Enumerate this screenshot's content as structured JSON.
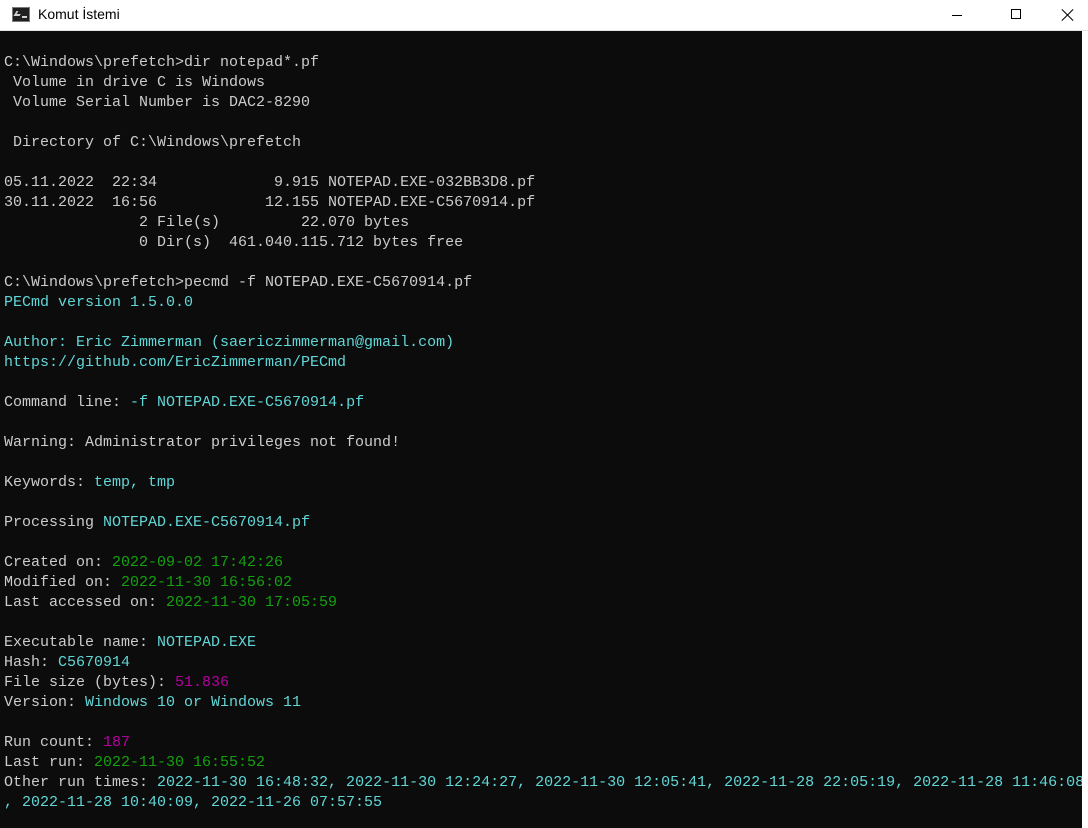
{
  "window": {
    "title": "Komut İstemi",
    "controls": {
      "minimize": "minimize",
      "maximize": "maximize",
      "close": "close"
    }
  },
  "colors": {
    "background": "#0c0c0c",
    "text": "#cccccc",
    "cyan": "#61d6d6",
    "green": "#13a10e",
    "magenta": "#b4009e"
  },
  "console": {
    "lines": [
      {
        "segments": [
          {
            "text": "C:\\Windows\\prefetch>dir notepad*.pf",
            "color": "w"
          }
        ]
      },
      {
        "segments": [
          {
            "text": " Volume in drive C is Windows",
            "color": "w"
          }
        ]
      },
      {
        "segments": [
          {
            "text": " Volume Serial Number is DAC2-8290",
            "color": "w"
          }
        ]
      },
      {
        "segments": []
      },
      {
        "segments": [
          {
            "text": " Directory of C:\\Windows\\prefetch",
            "color": "w"
          }
        ]
      },
      {
        "segments": []
      },
      {
        "segments": [
          {
            "text": "05.11.2022  22:34             9.915 NOTEPAD.EXE-032BB3D8.pf",
            "color": "w"
          }
        ]
      },
      {
        "segments": [
          {
            "text": "30.11.2022  16:56            12.155 NOTEPAD.EXE-C5670914.pf",
            "color": "w"
          }
        ]
      },
      {
        "segments": [
          {
            "text": "               2 File(s)         22.070 bytes",
            "color": "w"
          }
        ]
      },
      {
        "segments": [
          {
            "text": "               0 Dir(s)  461.040.115.712 bytes free",
            "color": "w"
          }
        ]
      },
      {
        "segments": []
      },
      {
        "segments": [
          {
            "text": "C:\\Windows\\prefetch>pecmd -f NOTEPAD.EXE-C5670914.pf",
            "color": "w"
          }
        ]
      },
      {
        "segments": [
          {
            "text": "PECmd version 1.5.0.0",
            "color": "c"
          }
        ]
      },
      {
        "segments": []
      },
      {
        "segments": [
          {
            "text": "Author: Eric Zimmerman (saericzimmerman@gmail.com)",
            "color": "c"
          }
        ]
      },
      {
        "segments": [
          {
            "text": "https://github.com/EricZimmerman/PECmd",
            "color": "c"
          }
        ]
      },
      {
        "segments": []
      },
      {
        "segments": [
          {
            "text": "Command line: ",
            "color": "w"
          },
          {
            "text": "-f NOTEPAD.EXE-C5670914.pf",
            "color": "c"
          }
        ]
      },
      {
        "segments": []
      },
      {
        "segments": [
          {
            "text": "Warning: Administrator privileges not found!",
            "color": "w"
          }
        ]
      },
      {
        "segments": []
      },
      {
        "segments": [
          {
            "text": "Keywords: ",
            "color": "w"
          },
          {
            "text": "temp, tmp",
            "color": "c"
          }
        ]
      },
      {
        "segments": []
      },
      {
        "segments": [
          {
            "text": "Processing ",
            "color": "w"
          },
          {
            "text": "NOTEPAD.EXE-C5670914.pf",
            "color": "c"
          }
        ]
      },
      {
        "segments": []
      },
      {
        "segments": [
          {
            "text": "Created on: ",
            "color": "w"
          },
          {
            "text": "2022-09-02 17:42:26",
            "color": "g"
          }
        ]
      },
      {
        "segments": [
          {
            "text": "Modified on: ",
            "color": "w"
          },
          {
            "text": "2022-11-30 16:56:02",
            "color": "g"
          }
        ]
      },
      {
        "segments": [
          {
            "text": "Last accessed on: ",
            "color": "w"
          },
          {
            "text": "2022-11-30 17:05:59",
            "color": "g"
          }
        ]
      },
      {
        "segments": []
      },
      {
        "segments": [
          {
            "text": "Executable name: ",
            "color": "w"
          },
          {
            "text": "NOTEPAD.EXE",
            "color": "c"
          }
        ]
      },
      {
        "segments": [
          {
            "text": "Hash: ",
            "color": "w"
          },
          {
            "text": "C5670914",
            "color": "c"
          }
        ]
      },
      {
        "segments": [
          {
            "text": "File size (bytes): ",
            "color": "w"
          },
          {
            "text": "51.836",
            "color": "m"
          }
        ]
      },
      {
        "segments": [
          {
            "text": "Version: ",
            "color": "w"
          },
          {
            "text": "Windows 10 or Windows 11",
            "color": "c"
          }
        ]
      },
      {
        "segments": []
      },
      {
        "segments": [
          {
            "text": "Run count: ",
            "color": "w"
          },
          {
            "text": "187",
            "color": "m"
          }
        ]
      },
      {
        "segments": [
          {
            "text": "Last run: ",
            "color": "w"
          },
          {
            "text": "2022-11-30 16:55:52",
            "color": "g"
          }
        ]
      },
      {
        "segments": [
          {
            "text": "Other run times: ",
            "color": "w"
          },
          {
            "text": "2022-11-30 16:48:32, 2022-11-30 12:24:27, 2022-11-30 12:05:41, 2022-11-28 22:05:19, 2022-11-28 11:46:08",
            "color": "c"
          }
        ]
      },
      {
        "segments": [
          {
            "text": ", 2022-11-28 10:40:09, 2022-11-26 07:57:55",
            "color": "c"
          }
        ]
      }
    ]
  }
}
